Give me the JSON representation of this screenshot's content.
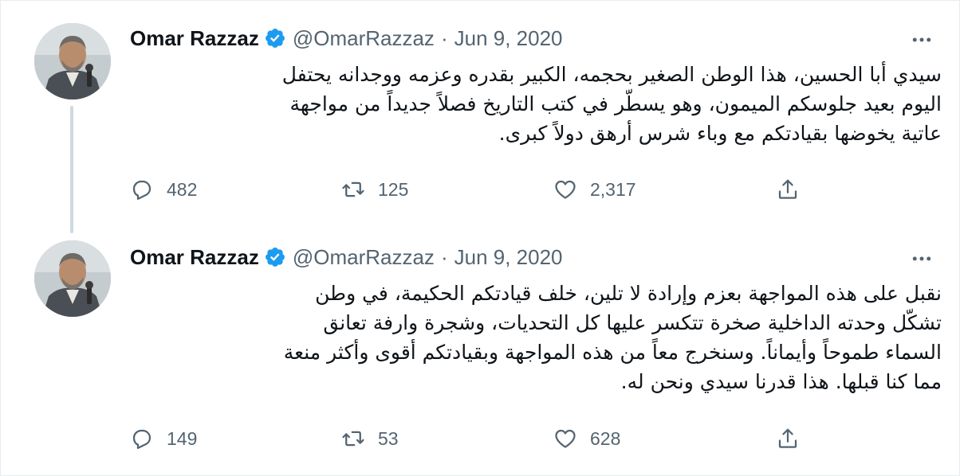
{
  "tweets": [
    {
      "name": "Omar Razzaz",
      "handle": "@OmarRazzaz",
      "separator": "·",
      "date": "Jun 9, 2020",
      "lines": [
        "سيدي أبا الحسين، هذا الوطن الصغير بحجمه، الكبير بقدره وعزمه ووجدانه يحتفل",
        "اليوم بعيد جلوسكم الميمون، وهو يسطّر في كتب التاريخ فصلاً جديداً من مواجهة",
        "عاتية يخوضها بقيادتكم مع وباء شرس أرهق دولاً كبرى."
      ],
      "replies": "482",
      "retweets": "125",
      "likes": "2,317"
    },
    {
      "name": "Omar Razzaz",
      "handle": "@OmarRazzaz",
      "separator": "·",
      "date": "Jun 9, 2020",
      "lines": [
        "نقبل على هذه المواجهة بعزم وإرادة لا تلين، خلف قيادتكم الحكيمة، في وطن",
        "تشكّل وحدته الداخلية صخرة تتكسر عليها كل التحديات، وشجرة وارفة تعانق",
        "السماء طموحاً وأيماناً. وسنخرج معاً من هذه المواجهة وبقيادتكم أقوى وأكثر منعة",
        "مما كنا قبلها. هذا قدرنا سيدي ونحن له."
      ],
      "replies": "149",
      "retweets": "53",
      "likes": "628"
    }
  ],
  "icons": {
    "verified": "verified-badge-icon",
    "more": "more-dots-icon",
    "reply": "reply-icon",
    "retweet": "retweet-icon",
    "like": "heart-icon",
    "share": "share-icon"
  },
  "colors": {
    "verified": "#1d9bf0",
    "secondary_text": "#536471",
    "thread_line": "#cfd9de"
  }
}
